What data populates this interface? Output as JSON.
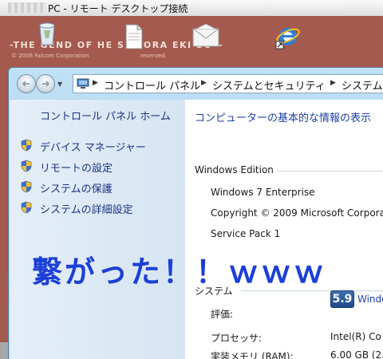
{
  "rdp": {
    "title": "PC - リモート デスクトップ接続"
  },
  "desktop": {
    "wallpaper_text": "-THE   GEND OF HE   S “SORA    EKI SC”-",
    "copyright": "© 2006     Falcom Corporation",
    "reserved": "reserved."
  },
  "address_bar": {
    "crumbs": [
      "コントロール パネル",
      "システムとセキュリティ",
      "システム"
    ]
  },
  "left_pane": {
    "home_link": "コントロール パネル ホーム",
    "tasks": [
      {
        "label": "デバイス マネージャー"
      },
      {
        "label": "リモートの設定"
      },
      {
        "label": "システムの保護"
      },
      {
        "label": "システムの詳細設定"
      }
    ]
  },
  "main": {
    "heading": "コンピューターの基本的な情報の表示",
    "edition": {
      "title": "Windows Edition",
      "values": [
        "Windows 7 Enterprise",
        "Copyright © 2009 Microsoft Corporat",
        "Service Pack 1"
      ]
    },
    "system": {
      "title": "システム",
      "rating_label": "評価:",
      "rating_score": "5.9",
      "rating_link": "Windo",
      "processor_label": "プロセッサ:",
      "processor_value": "Intel(R) Co",
      "ram_label": "実装メモリ (RAM):",
      "ram_value": "6.00 GB (2.9"
    }
  },
  "overlay": {
    "caption": "繋がった！！ｗｗｗ"
  },
  "colors": {
    "desktop_bg": "#a45a4e",
    "link_blue": "#1e3287",
    "caption_blue": "#1c3fd6"
  }
}
